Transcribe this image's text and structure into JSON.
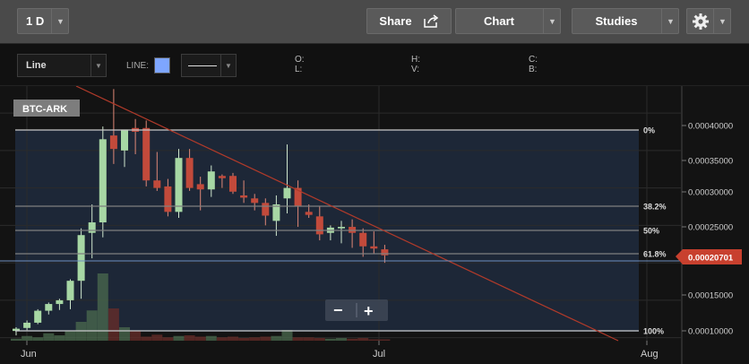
{
  "toolbar": {
    "interval": "1 D",
    "share_label": "Share",
    "chart_label": "Chart",
    "studies_label": "Studies",
    "settings_icon": "gear-icon"
  },
  "subbar": {
    "chart_type": "Line",
    "line_label": "LINE:",
    "line_color": "#7ea6ff",
    "ohlc": {
      "o": "O:",
      "l": "L:",
      "h": "H:",
      "v": "V:",
      "c": "C:",
      "b": "B:"
    }
  },
  "chart": {
    "symbol": "BTC-ARK",
    "price_axis": [
      "0.00040000",
      "0.00035000",
      "0.00030000",
      "0.00025000",
      "0.00015000",
      "0.00010000"
    ],
    "time_axis": [
      "Jun",
      "Jul",
      "Aug"
    ],
    "fib_labels": [
      "0%",
      "38.2%",
      "50%",
      "61.8%",
      "100%"
    ],
    "last_price": "0.00020701",
    "zoom_out": "−",
    "zoom_in": "+"
  },
  "chart_data": {
    "type": "candlestick",
    "ylim": [
      9.6e-05,
      0.000436
    ],
    "candles": [
      {
        "o": 0.000109,
        "h": 0.000114,
        "l": 0.000103,
        "c": 0.000112
      },
      {
        "o": 0.000113,
        "h": 0.000123,
        "l": 0.00011,
        "c": 0.00012
      },
      {
        "o": 0.00012,
        "h": 0.000138,
        "l": 0.000118,
        "c": 0.000136
      },
      {
        "o": 0.000136,
        "h": 0.000147,
        "l": 0.000131,
        "c": 0.000145
      },
      {
        "o": 0.000145,
        "h": 0.000152,
        "l": 0.000137,
        "c": 0.00015
      },
      {
        "o": 0.00015,
        "h": 0.000178,
        "l": 0.000138,
        "c": 0.000176
      },
      {
        "o": 0.000176,
        "h": 0.000246,
        "l": 0.000152,
        "c": 0.000237
      },
      {
        "o": 0.00024,
        "h": 0.000278,
        "l": 0.000206,
        "c": 0.000254
      },
      {
        "o": 0.000254,
        "h": 0.000382,
        "l": 0.000234,
        "c": 0.000365
      },
      {
        "o": 0.00037,
        "h": 0.000432,
        "l": 0.000332,
        "c": 0.000352
      },
      {
        "o": 0.00035,
        "h": 0.000378,
        "l": 0.000328,
        "c": 0.000378
      },
      {
        "o": 0.00038,
        "h": 0.000392,
        "l": 0.000345,
        "c": 0.000375
      },
      {
        "o": 0.00038,
        "h": 0.00039,
        "l": 0.000302,
        "c": 0.00031
      },
      {
        "o": 0.00031,
        "h": 0.000348,
        "l": 0.000296,
        "c": 0.0003
      },
      {
        "o": 0.000302,
        "h": 0.000312,
        "l": 0.000262,
        "c": 0.000268
      },
      {
        "o": 0.000268,
        "h": 0.000352,
        "l": 0.00026,
        "c": 0.00034
      },
      {
        "o": 0.00034,
        "h": 0.000352,
        "l": 0.000296,
        "c": 0.0003
      },
      {
        "o": 0.000305,
        "h": 0.000315,
        "l": 0.00027,
        "c": 0.000298
      },
      {
        "o": 0.000298,
        "h": 0.00033,
        "l": 0.000288,
        "c": 0.000322
      },
      {
        "o": 0.000316,
        "h": 0.000318,
        "l": 0.0003,
        "c": 0.000313
      },
      {
        "o": 0.000316,
        "h": 0.00032,
        "l": 0.000292,
        "c": 0.000295
      },
      {
        "o": 0.00029,
        "h": 0.00031,
        "l": 0.00028,
        "c": 0.000287
      },
      {
        "o": 0.000286,
        "h": 0.000292,
        "l": 0.00027,
        "c": 0.00028
      },
      {
        "o": 0.00028,
        "h": 0.000286,
        "l": 0.00025,
        "c": 0.000263
      },
      {
        "o": 0.000256,
        "h": 0.00029,
        "l": 0.000236,
        "c": 0.000278
      },
      {
        "o": 0.000286,
        "h": 0.000358,
        "l": 0.000266,
        "c": 0.0003
      },
      {
        "o": 0.0003,
        "h": 0.00031,
        "l": 0.000248,
        "c": 0.000276
      },
      {
        "o": 0.000268,
        "h": 0.000278,
        "l": 0.00026,
        "c": 0.000264
      },
      {
        "o": 0.000262,
        "h": 0.000276,
        "l": 0.00023,
        "c": 0.000238
      },
      {
        "o": 0.00024,
        "h": 0.00025,
        "l": 0.00023,
        "c": 0.000247
      },
      {
        "o": 0.000246,
        "h": 0.000256,
        "l": 0.000226,
        "c": 0.000248
      },
      {
        "o": 0.000248,
        "h": 0.000258,
        "l": 0.00022,
        "c": 0.00024
      },
      {
        "o": 0.00024,
        "h": 0.000246,
        "l": 0.000208,
        "c": 0.000222
      },
      {
        "o": 0.000222,
        "h": 0.000242,
        "l": 0.000212,
        "c": 0.000219
      },
      {
        "o": 0.000218,
        "h": 0.000224,
        "l": 0.0002,
        "c": 0.00021
      }
    ],
    "volume_levels": [
      0.03,
      0.07,
      0.05,
      0.11,
      0.08,
      0.15,
      0.28,
      0.45,
      1.0,
      0.48,
      0.2,
      0.14,
      0.06,
      0.09,
      0.05,
      0.07,
      0.08,
      0.06,
      0.07,
      0.05,
      0.06,
      0.04,
      0.05,
      0.06,
      0.07,
      0.16,
      0.05,
      0.05,
      0.04,
      0.03,
      0.04,
      0.03,
      0.04,
      0.02,
      0.02
    ]
  }
}
